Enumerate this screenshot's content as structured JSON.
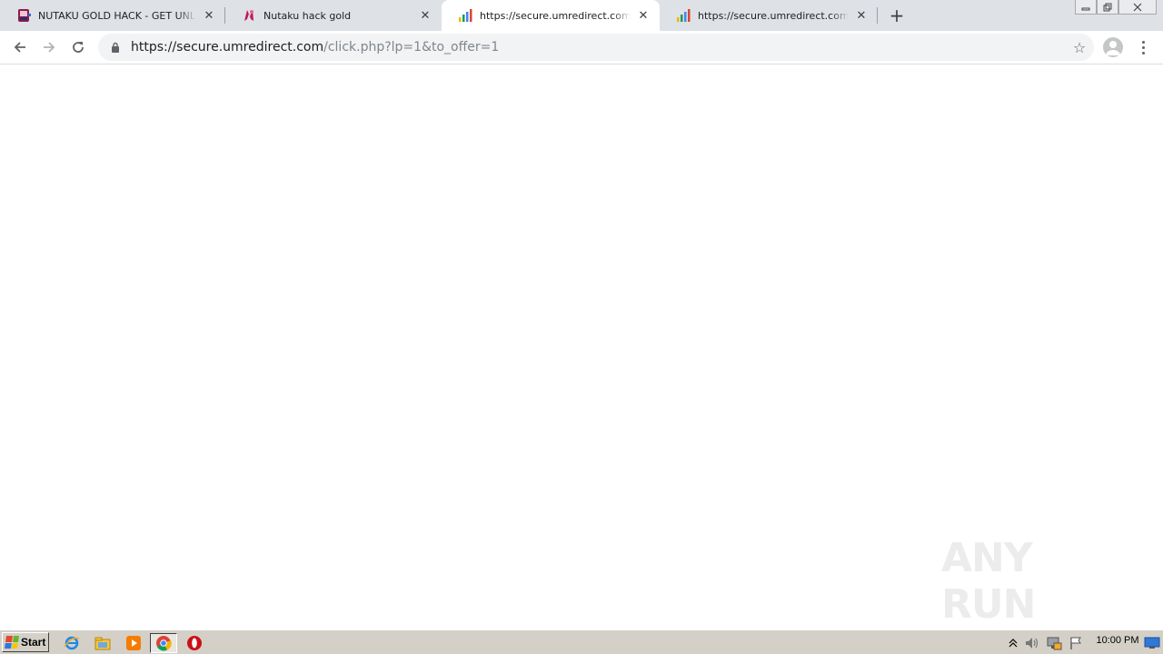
{
  "tabs": [
    {
      "title": "NUTAKU GOLD HACK - GET UNLIMITED",
      "favicon": "nutaku-favicon",
      "active": false
    },
    {
      "title": "Nutaku hack gold",
      "favicon": "nutaku-n-favicon",
      "active": false
    },
    {
      "title": "https://secure.umredirect.com/click.php",
      "favicon": "bar-chart-favicon",
      "active": true
    },
    {
      "title": "https://secure.umredirect.com/click.php",
      "favicon": "bar-chart-favicon",
      "active": false
    }
  ],
  "tab_close_glyph": "✕",
  "new_tab_glyph": "+",
  "omnibox": {
    "url_host": "https://secure.umredirect.com",
    "url_path": "/click.php?lp=1&to_offer=1"
  },
  "watermark": "ANY RUN",
  "taskbar": {
    "start_label": "Start",
    "clock": "10:00 PM"
  },
  "colors": {
    "tabstrip_bg": "#dee1e6",
    "taskbar_bg": "#d4d0c8",
    "omnibox_bg": "#f1f3f4"
  }
}
